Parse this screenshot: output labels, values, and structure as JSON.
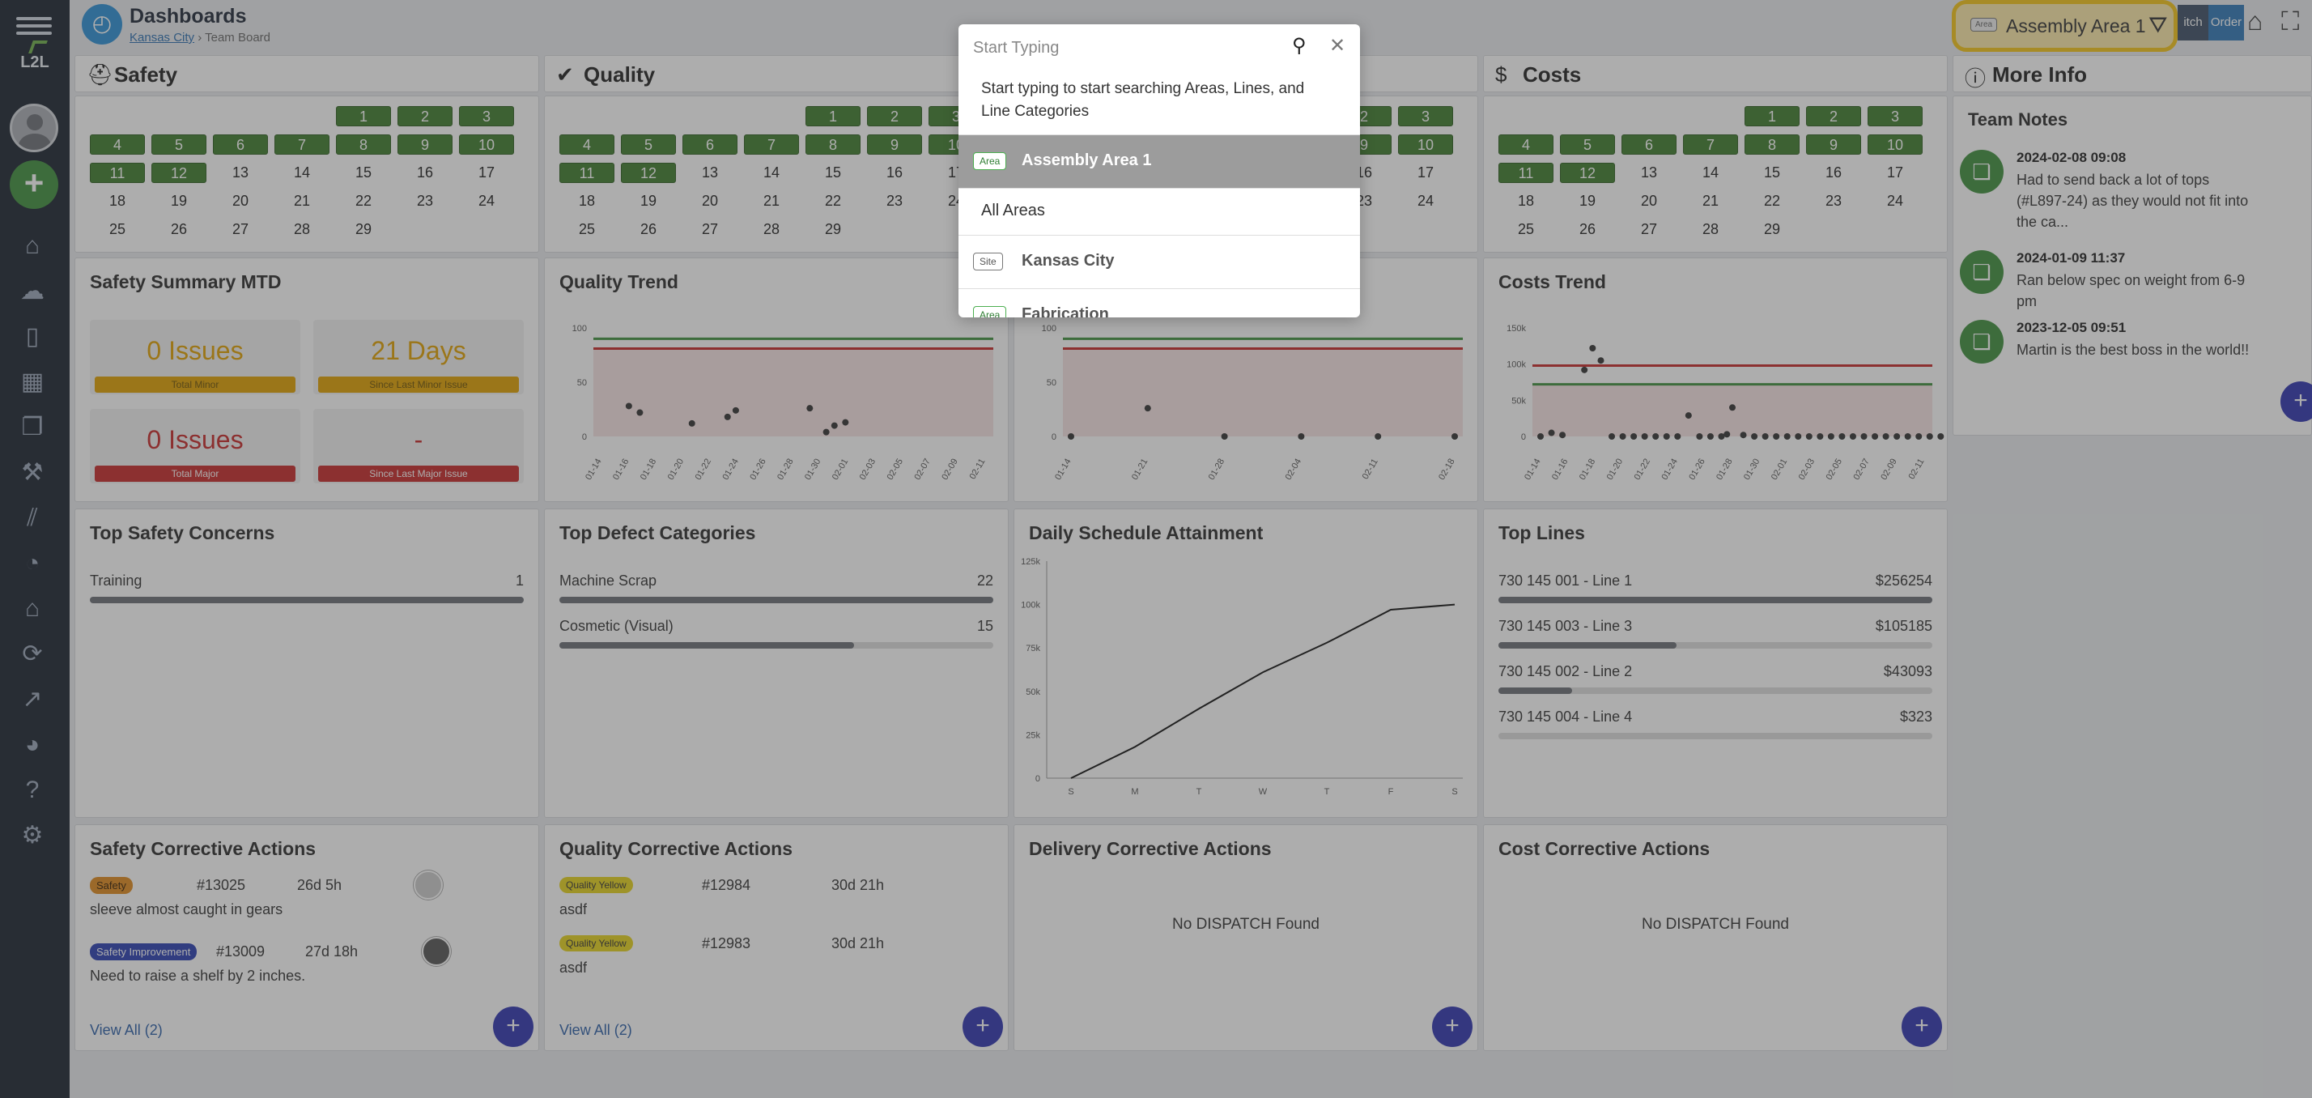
{
  "header": {
    "title": "Dashboards",
    "crumb_site": "Kansas City",
    "crumb_sep": "›",
    "crumb_page": "Team Board",
    "area_tag": "Area",
    "area_label": "Assembly Area 1",
    "btn_pitch": "itch",
    "btn_order": "Order"
  },
  "sidebar": {
    "logo": "L2L"
  },
  "sections": {
    "safety": "Safety",
    "quality": "Quality",
    "delivery": "",
    "costs": "Costs",
    "more_info": "More Info"
  },
  "calendar": {
    "row1": [
      "1",
      "2",
      "3"
    ],
    "row2": [
      "4",
      "5",
      "6",
      "7",
      "8",
      "9",
      "10"
    ],
    "row3": [
      "11",
      "12",
      "13",
      "14",
      "15",
      "16",
      "17"
    ],
    "row4": [
      "18",
      "19",
      "20",
      "21",
      "22",
      "23",
      "24"
    ],
    "row5": [
      "25",
      "26",
      "27",
      "28",
      "29"
    ]
  },
  "safety_summary": {
    "title": "Safety Summary MTD",
    "kpis": [
      {
        "value": "0 Issues",
        "label": "Total Minor"
      },
      {
        "value": "21 Days",
        "label": "Since Last Minor Issue"
      },
      {
        "value": "0 Issues",
        "label": "Total Major"
      },
      {
        "value": "-",
        "label": "Since Last Major Issue"
      }
    ]
  },
  "quality_trend": {
    "title": "Quality Trend"
  },
  "costs_trend": {
    "title": "Costs Trend"
  },
  "chart_data": [
    {
      "type": "scatter",
      "title": "Quality Trend",
      "ylim": [
        0,
        100
      ],
      "yticks": [
        "0",
        "50",
        "100"
      ],
      "x": [
        "01-14",
        "01-16",
        "01-18",
        "01-20",
        "01-22",
        "01-24",
        "01-26",
        "01-28",
        "01-30",
        "02-01",
        "02-03",
        "02-05",
        "02-07",
        "02-09",
        "02-11"
      ],
      "points": [
        [
          1,
          28
        ],
        [
          1.4,
          22
        ],
        [
          3.3,
          12
        ],
        [
          4.6,
          18
        ],
        [
          4.9,
          24
        ],
        [
          7.6,
          26
        ],
        [
          8.2,
          4
        ],
        [
          8.5,
          10
        ],
        [
          8.9,
          13
        ]
      ],
      "upper_line": 90,
      "lower_line": 81
    },
    {
      "type": "scatter",
      "title": "",
      "ylim": [
        0,
        100
      ],
      "yticks": [
        "0",
        "50",
        "100"
      ],
      "x": [
        "01-14",
        "01-21",
        "01-28",
        "02-04",
        "02-11",
        "02-18"
      ],
      "points": [
        [
          0,
          0
        ],
        [
          1,
          26
        ],
        [
          2,
          0
        ],
        [
          3,
          0
        ],
        [
          4,
          0
        ],
        [
          5,
          0
        ]
      ],
      "upper_line": 90,
      "lower_line": 81
    },
    {
      "type": "scatter",
      "title": "Costs Trend",
      "ylim": [
        0,
        150000
      ],
      "yticks": [
        "0",
        "50k",
        "100k",
        "150k"
      ],
      "x": [
        "01-14",
        "01-16",
        "01-18",
        "01-20",
        "01-22",
        "01-24",
        "01-26",
        "01-28",
        "01-30",
        "02-01",
        "02-03",
        "02-05",
        "02-07",
        "02-09",
        "02-11"
      ],
      "points": [
        [
          0,
          0
        ],
        [
          0.4,
          5000
        ],
        [
          0.8,
          2000
        ],
        [
          1.6,
          92000
        ],
        [
          1.9,
          122000
        ],
        [
          2.2,
          105000
        ],
        [
          2.6,
          0
        ],
        [
          3,
          0
        ],
        [
          3.4,
          0
        ],
        [
          3.8,
          0
        ],
        [
          4.2,
          0
        ],
        [
          4.6,
          0
        ],
        [
          5,
          0
        ],
        [
          5.4,
          29000
        ],
        [
          5.8,
          0
        ],
        [
          6.2,
          0
        ],
        [
          6.6,
          0
        ],
        [
          6.8,
          3000
        ],
        [
          7,
          40000
        ],
        [
          7.4,
          2000
        ],
        [
          7.8,
          0
        ],
        [
          8.2,
          0
        ],
        [
          8.6,
          0
        ],
        [
          9,
          0
        ],
        [
          9.4,
          0
        ],
        [
          9.8,
          0
        ],
        [
          10.2,
          0
        ],
        [
          10.6,
          0
        ],
        [
          11,
          0
        ],
        [
          11.4,
          0
        ],
        [
          11.8,
          0
        ],
        [
          12.2,
          0
        ],
        [
          12.6,
          0
        ],
        [
          13,
          0
        ],
        [
          13.4,
          0
        ],
        [
          13.8,
          0
        ],
        [
          14.2,
          0
        ],
        [
          14.6,
          0
        ]
      ],
      "upper_line": 98000,
      "lower_line": 72000
    },
    {
      "type": "line",
      "title": "Daily Schedule Attainment",
      "ylim": [
        0,
        125000
      ],
      "yticks": [
        "0",
        "25k",
        "50k",
        "75k",
        "100k",
        "125k"
      ],
      "categories": [
        "S",
        "M",
        "T",
        "W",
        "T",
        "F",
        "S"
      ],
      "values": [
        0,
        18000,
        40000,
        61000,
        78000,
        97000,
        100000
      ]
    }
  ],
  "top_safety": {
    "title": "Top Safety Concerns",
    "items": [
      {
        "label": "Training",
        "value": "1",
        "pct": 1.0
      }
    ]
  },
  "top_defects": {
    "title": "Top Defect Categories",
    "items": [
      {
        "label": "Machine Scrap",
        "value": "22",
        "pct": 1.0
      },
      {
        "label": "Cosmetic (Visual)",
        "value": "15",
        "pct": 0.68
      }
    ]
  },
  "schedule": {
    "title": "Daily Schedule Attainment"
  },
  "top_lines": {
    "title": "Top Lines",
    "items": [
      {
        "label": "730 145 001 - Line 1",
        "value": "$256254",
        "pct": 1.0
      },
      {
        "label": "730 145 003 - Line 3",
        "value": "$105185",
        "pct": 0.41
      },
      {
        "label": "730 145 002 - Line 2",
        "value": "$43093",
        "pct": 0.17
      },
      {
        "label": "730 145 004 - Line 4",
        "value": "$323",
        "pct": 0.0
      }
    ]
  },
  "safety_ca": {
    "title": "Safety Corrective Actions",
    "view_all": "View All (2)",
    "items": [
      {
        "badge": "Safety",
        "num": "#13025",
        "age": "26d 5h",
        "desc": "sleeve almost caught in gears"
      },
      {
        "badge": "Safety Improvement",
        "num": "#13009",
        "age": "27d 18h",
        "desc": "Need to raise a shelf by 2 inches."
      }
    ]
  },
  "quality_ca": {
    "title": "Quality Corrective Actions",
    "view_all": "View All (2)",
    "items": [
      {
        "badge": "Quality Yellow",
        "num": "#12984",
        "age": "30d 21h",
        "desc": "asdf"
      },
      {
        "badge": "Quality Yellow",
        "num": "#12983",
        "age": "30d 21h",
        "desc": "asdf"
      }
    ]
  },
  "delivery_ca": {
    "title": "Delivery Corrective Actions",
    "empty": "No DISPATCH Found"
  },
  "cost_ca": {
    "title": "Cost Corrective Actions",
    "empty": "No DISPATCH Found"
  },
  "team_notes": {
    "title": "Team Notes",
    "items": [
      {
        "ts": "2024-02-08 09:08",
        "text": "Had to send back a lot of tops (#L897-24) as they would not fit into the ca..."
      },
      {
        "ts": "2024-01-09 11:37",
        "text": "Ran below spec on weight from 6-9 pm"
      },
      {
        "ts": "2023-12-05 09:51",
        "text": "Martin is the best boss in the world!!"
      }
    ]
  },
  "search": {
    "placeholder": "Start Typing",
    "hint": "Start typing to start searching Areas, Lines, and Line Categories",
    "options": [
      {
        "tag": "Area",
        "name": "Assembly Area 1"
      },
      {
        "tag": "",
        "name": "All Areas"
      },
      {
        "tag": "Site",
        "name": "Kansas City"
      },
      {
        "tag": "Area",
        "name": "Fabrication"
      }
    ]
  },
  "colors": {
    "green": "#3f7d2e",
    "orange": "#e0a000",
    "red": "#c62828",
    "accent": "#3035b0",
    "limit_green": "#3f8f3d",
    "limit_red": "#c62828"
  }
}
